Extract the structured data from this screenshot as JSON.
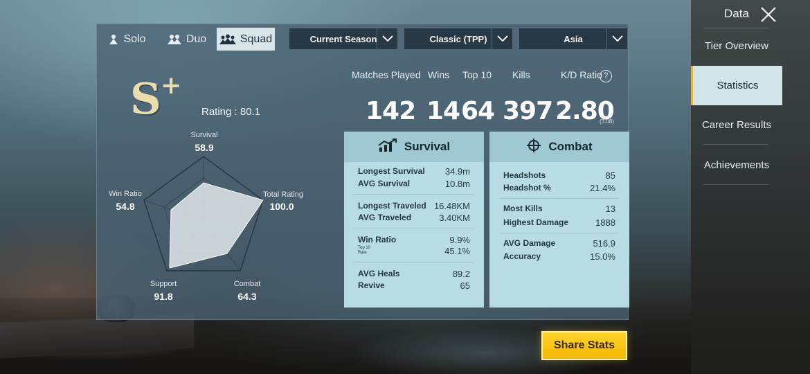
{
  "mode_tabs": [
    {
      "label": "Solo",
      "icon": "solo-icon"
    },
    {
      "label": "Duo",
      "icon": "duo-icon"
    },
    {
      "label": "Squad",
      "icon": "squad-icon",
      "active": true
    }
  ],
  "filters": {
    "season": "Current Season",
    "mode": "Classic (TPP)",
    "region": "Asia"
  },
  "rank": {
    "letter": "S",
    "plus": "+",
    "rating": "Rating : 80.1"
  },
  "radar": {
    "survival": {
      "label": "Survival",
      "value": "58.9"
    },
    "total_rating": {
      "label": "Total Rating",
      "value": "100.0"
    },
    "combat": {
      "label": "Combat",
      "value": "64.3"
    },
    "support": {
      "label": "Support",
      "value": "91.8"
    },
    "win_ratio": {
      "label": "Win Ratio",
      "value": "54.8"
    }
  },
  "summary": {
    "matches_played": {
      "label": "Matches Played",
      "value": "142"
    },
    "wins": {
      "label": "Wins",
      "value": "14"
    },
    "top10": {
      "label": "Top 10",
      "value": "64"
    },
    "kills": {
      "label": "Kills",
      "value": "397"
    },
    "kd_ratio": {
      "label": "K/D Ratio",
      "value": "2.80",
      "sub": "(3.08)"
    }
  },
  "survival_card": {
    "title": "Survival",
    "rows": [
      {
        "label": "Longest Survival",
        "value": "34.9m"
      },
      {
        "label": "AVG Survival",
        "value": "10.8m"
      },
      {
        "label": "Longest Traveled",
        "value": "16.48KM"
      },
      {
        "label": "AVG Traveled",
        "value": "3.40KM"
      },
      {
        "label": "Win Ratio",
        "value": "9.9%"
      },
      {
        "label": "Top 10 Rate",
        "value": "45.1%"
      },
      {
        "label": "AVG Heals",
        "value": "89.2"
      },
      {
        "label": "Revive",
        "value": "65"
      }
    ]
  },
  "combat_card": {
    "title": "Combat",
    "rows": [
      {
        "label": "Headshots",
        "value": "85"
      },
      {
        "label": "Headshot %",
        "value": "21.4%"
      },
      {
        "label": "Most Kills",
        "value": "13"
      },
      {
        "label": "Highest Damage",
        "value": "1888"
      },
      {
        "label": "AVG Damage",
        "value": "516.9"
      },
      {
        "label": "Accuracy",
        "value": "15.0%"
      }
    ]
  },
  "share_button": "Share Stats",
  "sidebar": {
    "title": "Data",
    "items": [
      {
        "label": "Tier Overview"
      },
      {
        "label": "Statistics",
        "active": true
      },
      {
        "label": "Career Results"
      },
      {
        "label": "Achievements"
      }
    ]
  },
  "colors": {
    "accent": "#f3b800",
    "card_bg": "#b7dce4",
    "rank_gold": "#e9dcae"
  }
}
